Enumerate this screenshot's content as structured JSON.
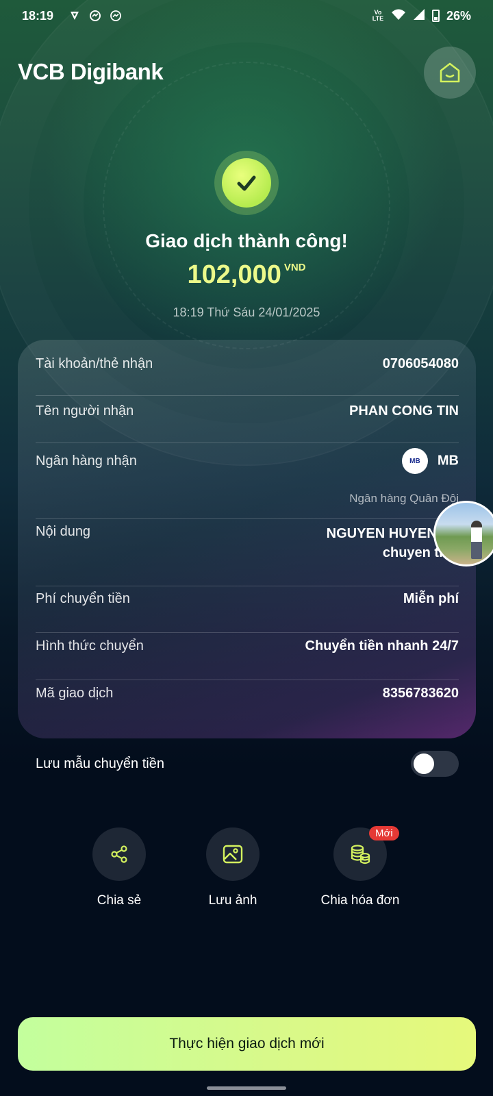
{
  "status_bar": {
    "time": "18:19",
    "network": "Vo LTE",
    "battery": "26%"
  },
  "app": {
    "logo": "VCB Digibank"
  },
  "result": {
    "title": "Giao dịch thành công!",
    "amount": "102,000",
    "currency": "VND",
    "datetime": "18:19 Thứ Sáu 24/01/2025"
  },
  "details": {
    "account_label": "Tài khoản/thẻ nhận",
    "account_value": "0706054080",
    "recipient_label": "Tên người nhận",
    "recipient_value": "PHAN CONG TIN",
    "bank_label": "Ngân hàng nhận",
    "bank_logo_text": "MB",
    "bank_value": "MB",
    "bank_fullname": "Ngân hàng Quân Đội",
    "content_label": "Nội dung",
    "content_line1": "NGUYEN HUYEN TR",
    "content_line2": "chuyen tien",
    "fee_label": "Phí chuyển tiền",
    "fee_value": "Miễn phí",
    "method_label": "Hình thức chuyển",
    "method_value": "Chuyển tiền nhanh 24/7",
    "txid_label": "Mã giao dịch",
    "txid_value": "8356783620"
  },
  "save_template": {
    "label": "Lưu mẫu chuyển tiền",
    "enabled": false
  },
  "actions": [
    {
      "label": "Chia sẻ",
      "icon": "share-icon"
    },
    {
      "label": "Lưu ảnh",
      "icon": "image-icon"
    },
    {
      "label": "Chia hóa đơn",
      "icon": "coins-icon",
      "badge": "Mới"
    }
  ],
  "cta": {
    "label": "Thực hiện giao dịch mới"
  },
  "colors": {
    "accent": "#e6f97b",
    "amount": "#ecf98a",
    "badge": "#e53935"
  }
}
